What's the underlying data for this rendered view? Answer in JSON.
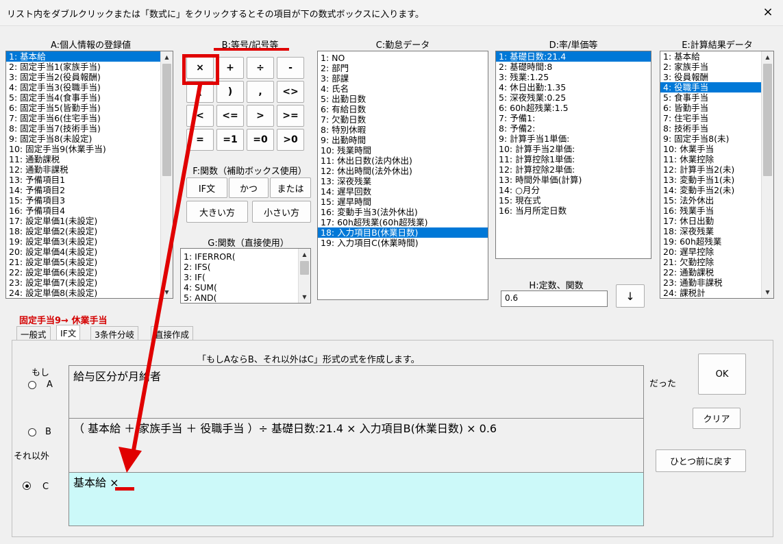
{
  "window": {
    "title": "リスト内をダブルクリックまたは「数式に」をクリックするとその項目が下の数式ボックスに入ります。",
    "close_icon": "×"
  },
  "sections": {
    "a": "A:個人情報の登録値",
    "b": "B:等号/記号等",
    "c": "C:勤怠データ",
    "d": "D:率/単価等",
    "e": "E:計算結果データ",
    "f": "F:関数（補助ボックス使用）",
    "g": "G:関数（直接使用）",
    "h": "H:定数、関数"
  },
  "list_a": [
    "1: 基本給",
    "2: 固定手当1(家族手当)",
    "3: 固定手当2(役員報酬)",
    "4: 固定手当3(役職手当)",
    "5: 固定手当4(食事手当)",
    "6: 固定手当5(皆勤手当)",
    "7: 固定手当6(住宅手当)",
    "8: 固定手当7(技術手当)",
    "9: 固定手当8(未設定)",
    "10: 固定手当9(休業手当)",
    "11: 通勤課税",
    "12: 通勤非課税",
    "13: 予備項目1",
    "14: 予備項目2",
    "15: 予備項目3",
    "16: 予備項目4",
    "17: 設定単価1(未設定)",
    "18: 設定単価2(未設定)",
    "19: 設定単価3(未設定)",
    "20: 設定単価4(未設定)",
    "21: 設定単価5(未設定)",
    "22: 設定単価6(未設定)",
    "23: 設定単価7(未設定)",
    "24: 設定単価8(未設定)"
  ],
  "list_c": [
    "1: NO",
    "2: 部門",
    "3: 部課",
    "4: 氏名",
    "5: 出勤日数",
    "6: 有給日数",
    "7: 欠勤日数",
    "8: 特別休暇",
    "9: 出勤時間",
    "10: 残業時間",
    "11: 休出日数(法内休出)",
    "12: 休出時間(法外休出)",
    "13: 深夜残業",
    "14: 遅早回数",
    "15: 遅早時間",
    "16: 変動手当3(法外休出)",
    "17: 60h超残業(60h超残業)",
    "18: 入力項目B(休業日数)",
    "19: 入力項目C(休業時間)"
  ],
  "list_d": [
    "1: 基礎日数:21.4",
    "2: 基礎時間:8",
    "3: 残業:1.25",
    "4: 休日出勤:1.35",
    "5: 深夜残業:0.25",
    "6: 60h超残業:1.5",
    "7: 予備1:",
    "8: 予備2:",
    "9: 計算手当1単価:",
    "10: 計算手当2単価:",
    "11: 計算控除1単価:",
    "12: 計算控除2単価:",
    "13: 時間外単価(計算)",
    "14: ○月分",
    "15: 現在式",
    "16: 当月所定日数"
  ],
  "list_e": [
    "1: 基本給",
    "2: 家族手当",
    "3: 役員報酬",
    "4: 役職手当",
    "5: 食事手当",
    "6: 皆勤手当",
    "7: 住宅手当",
    "8: 技術手当",
    "9: 固定手当8(未)",
    "10: 休業手当",
    "11: 休業控除",
    "12: 計算手当2(未)",
    "13: 変動手当1(未)",
    "14: 変動手当2(未)",
    "15: 法外休出",
    "16: 残業手当",
    "17: 休日出勤",
    "18: 深夜残業",
    "19: 60h超残業",
    "20: 遅早控除",
    "21: 欠勤控除",
    "22: 通勤課税",
    "23: 通勤非課税",
    "24: 課税計"
  ],
  "list_g": [
    "1: IFERROR(",
    "2: IFS(",
    "3: IF(",
    "4: SUM(",
    "5: AND("
  ],
  "ops": [
    "×",
    "+",
    "÷",
    "-",
    "(",
    ")",
    ",",
    "<>",
    "<",
    "<=",
    ">",
    ">=",
    "=",
    "=1",
    "=0",
    ">0"
  ],
  "func_buttons": [
    "IF文",
    "かつ",
    "または",
    "大きい方",
    "小さい方"
  ],
  "h_value": "0.6",
  "h_button": "↓",
  "current_item": "固定手当9→ 休業手当",
  "tabs": [
    "一般式",
    "IF文",
    "3条件分岐",
    "直接作成"
  ],
  "panel": {
    "hint": "「もしAならB、それ以外はC」形式の式を作成します。",
    "moshi": "もし",
    "label_a": "A",
    "label_b": "B",
    "label_c": "C",
    "sore_igai": "それ以外",
    "datta": "だった",
    "formula_a": "給与区分が月給者",
    "formula_b": "（ 基本給 ＋ 家族手当 ＋ 役職手当 ）÷ 基礎日数:21.4 × 入力項目B(休業日数) × 0.6",
    "formula_c": "基本給 ×",
    "ok": "OK",
    "clear": "クリア",
    "undo": "ひとつ前に戻す"
  }
}
